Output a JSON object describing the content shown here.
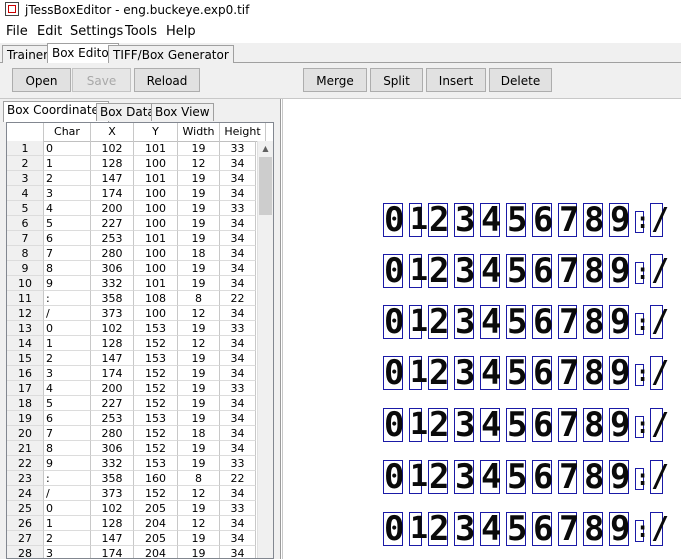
{
  "window": {
    "title": "jTessBoxEditor - eng.buckeye.exp0.tif"
  },
  "menu": [
    "File",
    "Edit",
    "Settings",
    "Tools",
    "Help"
  ],
  "main_tabs": [
    "Trainer",
    "Box Editor",
    "TIFF/Box Generator"
  ],
  "toolbar": {
    "open": "Open",
    "save": "Save",
    "reload": "Reload",
    "merge": "Merge",
    "split": "Split",
    "insert": "Insert",
    "delete": "Delete"
  },
  "sub_tabs": [
    "Box Coordinates",
    "Box Data",
    "Box View"
  ],
  "table": {
    "headers": [
      "",
      "Char",
      "X",
      "Y",
      "Width",
      "Height"
    ],
    "rows": [
      [
        "1",
        "0",
        "102",
        "101",
        "19",
        "33"
      ],
      [
        "2",
        "1",
        "128",
        "100",
        "12",
        "34"
      ],
      [
        "3",
        "2",
        "147",
        "101",
        "19",
        "34"
      ],
      [
        "4",
        "3",
        "174",
        "100",
        "19",
        "34"
      ],
      [
        "5",
        "4",
        "200",
        "100",
        "19",
        "33"
      ],
      [
        "6",
        "5",
        "227",
        "100",
        "19",
        "34"
      ],
      [
        "7",
        "6",
        "253",
        "101",
        "19",
        "34"
      ],
      [
        "8",
        "7",
        "280",
        "100",
        "18",
        "34"
      ],
      [
        "9",
        "8",
        "306",
        "100",
        "19",
        "34"
      ],
      [
        "10",
        "9",
        "332",
        "101",
        "19",
        "34"
      ],
      [
        "11",
        ":",
        "358",
        "108",
        "8",
        "22"
      ],
      [
        "12",
        "/",
        "373",
        "100",
        "12",
        "34"
      ],
      [
        "13",
        "0",
        "102",
        "153",
        "19",
        "33"
      ],
      [
        "14",
        "1",
        "128",
        "152",
        "12",
        "34"
      ],
      [
        "15",
        "2",
        "147",
        "153",
        "19",
        "34"
      ],
      [
        "16",
        "3",
        "174",
        "152",
        "19",
        "34"
      ],
      [
        "17",
        "4",
        "200",
        "152",
        "19",
        "33"
      ],
      [
        "18",
        "5",
        "227",
        "152",
        "19",
        "34"
      ],
      [
        "19",
        "6",
        "253",
        "153",
        "19",
        "34"
      ],
      [
        "20",
        "7",
        "280",
        "152",
        "18",
        "34"
      ],
      [
        "21",
        "8",
        "306",
        "152",
        "19",
        "34"
      ],
      [
        "22",
        "9",
        "332",
        "153",
        "19",
        "33"
      ],
      [
        "23",
        ":",
        "358",
        "160",
        "8",
        "22"
      ],
      [
        "24",
        "/",
        "373",
        "152",
        "12",
        "34"
      ],
      [
        "25",
        "0",
        "102",
        "205",
        "19",
        "33"
      ],
      [
        "26",
        "1",
        "128",
        "204",
        "12",
        "34"
      ],
      [
        "27",
        "2",
        "147",
        "205",
        "19",
        "34"
      ],
      [
        "28",
        "3",
        "174",
        "204",
        "19",
        "34"
      ]
    ]
  },
  "image_glyphs": [
    "0",
    "1",
    "2",
    "3",
    "4",
    "5",
    "6",
    "7",
    "8",
    "9",
    ":",
    "/"
  ],
  "colors": {
    "box_border": "#1a1aa6"
  }
}
